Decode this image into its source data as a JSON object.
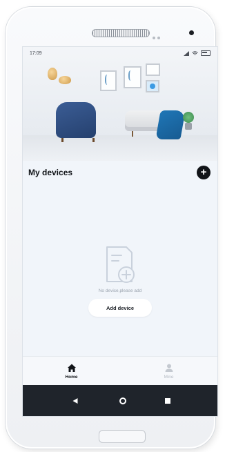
{
  "status_bar": {
    "time": "17:09"
  },
  "devices": {
    "title": "My devices",
    "add_icon_glyph": "+",
    "empty_message": "No device,please add",
    "add_button_label": "Add device"
  },
  "tabs": [
    {
      "label": "Home",
      "icon": "home-icon",
      "active": true
    },
    {
      "label": "Mine",
      "icon": "person-icon",
      "active": false
    }
  ],
  "nav": {
    "back_icon": "back-triangle-icon",
    "home_icon": "home-circle-icon",
    "recents_icon": "recents-square-icon"
  },
  "colors": {
    "screen_bg": "#f1f5fa",
    "accent_dark": "#111418",
    "nav_bar": "#1f242b",
    "inactive_tab": "#b6bcc4"
  }
}
